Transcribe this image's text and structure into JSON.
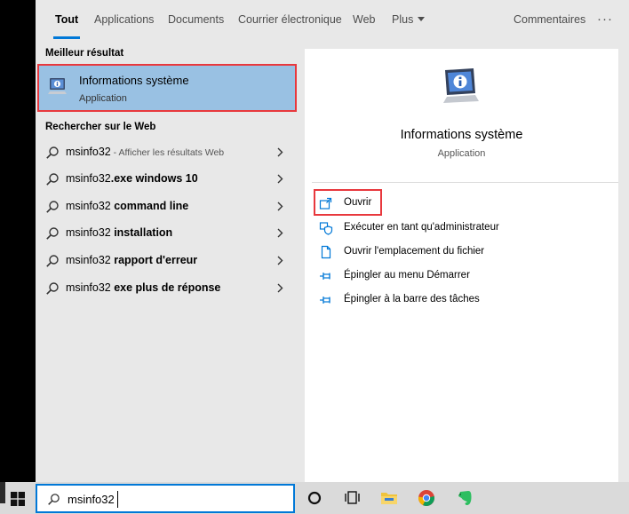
{
  "tabs": {
    "all": "Tout",
    "applications": "Applications",
    "documents": "Documents",
    "email": "Courrier électronique",
    "web": "Web",
    "more": "Plus",
    "feedback": "Commentaires",
    "ellipsis": "···"
  },
  "best_match": {
    "heading": "Meilleur résultat",
    "title": "Informations système",
    "subtitle": "Application",
    "icon": "system-information-icon"
  },
  "web_search": {
    "heading": "Rechercher sur le Web",
    "items": [
      {
        "query": "msinfo32",
        "bold": "",
        "suffix": " - Afficher les résultats Web"
      },
      {
        "query": "msinfo32",
        "bold": ".exe windows 10",
        "suffix": ""
      },
      {
        "query": "msinfo32 ",
        "bold": "command line",
        "suffix": ""
      },
      {
        "query": "msinfo32 ",
        "bold": "installation",
        "suffix": ""
      },
      {
        "query": "msinfo32 ",
        "bold": "rapport d'erreur",
        "suffix": ""
      },
      {
        "query": "msinfo32 ",
        "bold": "exe plus de réponse",
        "suffix": ""
      }
    ]
  },
  "detail": {
    "title": "Informations système",
    "subtitle": "Application",
    "actions": [
      {
        "label": "Ouvrir",
        "icon": "open-icon"
      },
      {
        "label": "Exécuter en tant qu'administrateur",
        "icon": "admin-shield-icon"
      },
      {
        "label": "Ouvrir l'emplacement du fichier",
        "icon": "file-location-icon"
      },
      {
        "label": "Épingler au menu Démarrer",
        "icon": "pin-icon"
      },
      {
        "label": "Épingler à la barre des tâches",
        "icon": "pin-icon"
      }
    ]
  },
  "taskbar": {
    "search_value": "msinfo32",
    "icons": [
      "windows-start-icon",
      "cortana-icon",
      "task-view-icon",
      "file-explorer-icon",
      "chrome-icon",
      "evernote-icon"
    ]
  },
  "colors": {
    "accent": "#0078d7",
    "selection": "#99c1e3",
    "highlight_border": "#e8383d",
    "panel_bg": "#e8e8e8"
  }
}
